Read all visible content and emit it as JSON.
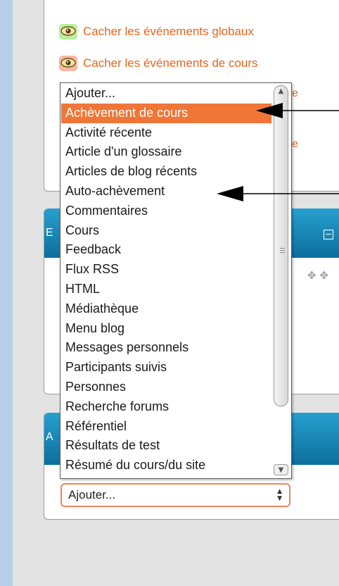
{
  "links": {
    "hide_global_events": "Cacher les événements globaux",
    "hide_course_events": "Cacher les événements de cours"
  },
  "peek_letters": [
    "e",
    "e"
  ],
  "blocks": {
    "middle_header_letter": "E",
    "bottom_header_letter": "A"
  },
  "block_list": {
    "options": [
      "Ajouter...",
      "Achèvement de cours",
      "Activité récente",
      "Article d'un glossaire",
      "Articles de blog récents",
      "Auto-achèvement",
      "Commentaires",
      "Cours",
      "Feedback",
      "Flux RSS",
      "HTML",
      "Médiathèque",
      "Menu blog",
      "Messages personnels",
      "Participants suivis",
      "Personnes",
      "Recherche forums",
      "Référentiel",
      "Résultats de test",
      "Résumé du cours/du site"
    ],
    "selected_option": "Achèvement de cours"
  },
  "add_select": {
    "value": "Ajouter..."
  },
  "icons": {
    "eye": "eye-icon",
    "collapse": "collapse-icon",
    "move": "move-icon"
  },
  "colors": {
    "link": "#e8641c",
    "selected_bg": "#f07638",
    "block_header": "#1687ba"
  }
}
